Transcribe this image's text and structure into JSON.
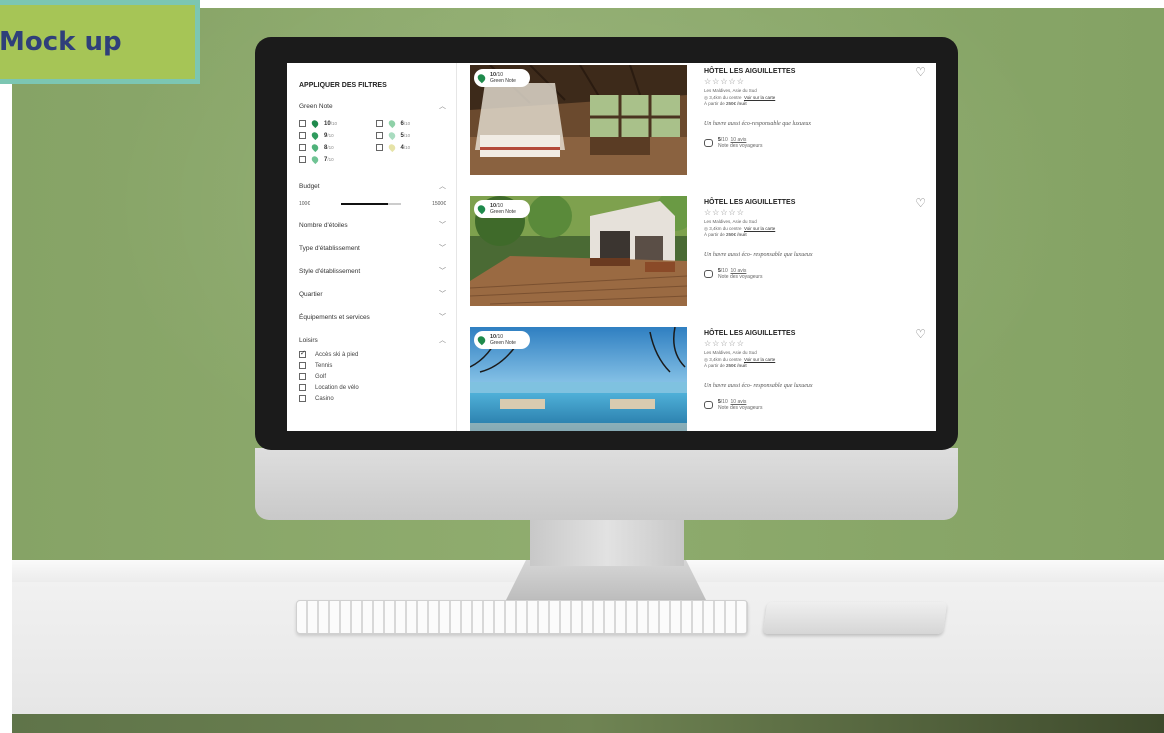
{
  "badge": {
    "label": "Mock up"
  },
  "filters": {
    "title": "APPLIQUER DES FILTRES",
    "green_note": {
      "label": "Green Note",
      "options": [
        {
          "value": "10",
          "suffix": "/10",
          "color": "#1f8a4c"
        },
        {
          "value": "6",
          "suffix": "/10",
          "color": "#8fd1a8"
        },
        {
          "value": "9",
          "suffix": "/10",
          "color": "#2f9b5e"
        },
        {
          "value": "5",
          "suffix": "/10",
          "color": "#a9dcc0"
        },
        {
          "value": "8",
          "suffix": "/10",
          "color": "#4fb27a"
        },
        {
          "value": "4",
          "suffix": "/10",
          "color": "#e6e3a8"
        },
        {
          "value": "7",
          "suffix": "/10",
          "color": "#6fc394"
        }
      ]
    },
    "budget": {
      "label": "Budget",
      "min": "100€",
      "max": "1500€",
      "fill_fraction": 0.78
    },
    "collapsed": [
      "Nombre d'étoiles",
      "Type d'établissement",
      "Style d'établissement",
      "Quartier",
      "Équipements et services"
    ],
    "leisure": {
      "label": "Loisirs",
      "items": [
        {
          "label": "Accès ski à pied",
          "checked": true
        },
        {
          "label": "Tennis",
          "checked": false
        },
        {
          "label": "Golf",
          "checked": false
        },
        {
          "label": "Location de vélo",
          "checked": false
        },
        {
          "label": "Casino",
          "checked": false
        }
      ]
    }
  },
  "hotels": [
    {
      "badge_score": "10",
      "badge_suffix": "/10",
      "badge_label": "Green Note",
      "name": "HÔTEL LES AIGUILLETTES",
      "stars": "☆☆☆☆☆",
      "location": "Les Maldives, Asie du Sud",
      "distance": "3,4km du centre",
      "map_link": "Voir sur la carte",
      "price_prefix": "À partir de ",
      "price": "250€ /nuit",
      "tagline": "Un havre aussi éco-responsable que luxueux",
      "rating": "5",
      "rating_suffix": "/10",
      "reviews": "10 avis",
      "rating_label": "Note des voyageurs"
    },
    {
      "badge_score": "10",
      "badge_suffix": "/10",
      "badge_label": "Green Note",
      "name": "HÔTEL LES AIGUILLETTES",
      "stars": "☆☆☆☆☆",
      "location": "Les Maldives, Asie du Sud",
      "distance": "3,4km du centre",
      "map_link": "Voir sur la carte",
      "price_prefix": "À partir de ",
      "price": "250€ /nuit",
      "tagline": "Un havre aussi éco- responsable que luxueux",
      "rating": "5",
      "rating_suffix": "/10",
      "reviews": "10 avis",
      "rating_label": "Note des voyageurs"
    },
    {
      "badge_score": "10",
      "badge_suffix": "/10",
      "badge_label": "Green Note",
      "name": "HÔTEL LES AIGUILLETTES",
      "stars": "☆☆☆☆☆",
      "location": "Les Maldives, Asie du Sud",
      "distance": "3,4km du centre",
      "map_link": "Voir sur la carte",
      "price_prefix": "À partir de ",
      "price": "250€ /nuit",
      "tagline": "Un havre aussi éco- responsable que luxueux",
      "rating": "5",
      "rating_suffix": "/10",
      "reviews": "10 avis",
      "rating_label": "Note des voyageurs"
    }
  ],
  "icons": {
    "heart": "heart-icon",
    "pin": "map-pin-icon",
    "chevron_up": "chevron-up-icon",
    "chevron_down": "chevron-down-icon",
    "chat": "chat-bubble-icon"
  },
  "colors": {
    "accent_green": "#1f8a4c",
    "badge_bg": "#a6c556",
    "badge_border": "#7cc6b2",
    "badge_text": "#2f3f7a"
  }
}
